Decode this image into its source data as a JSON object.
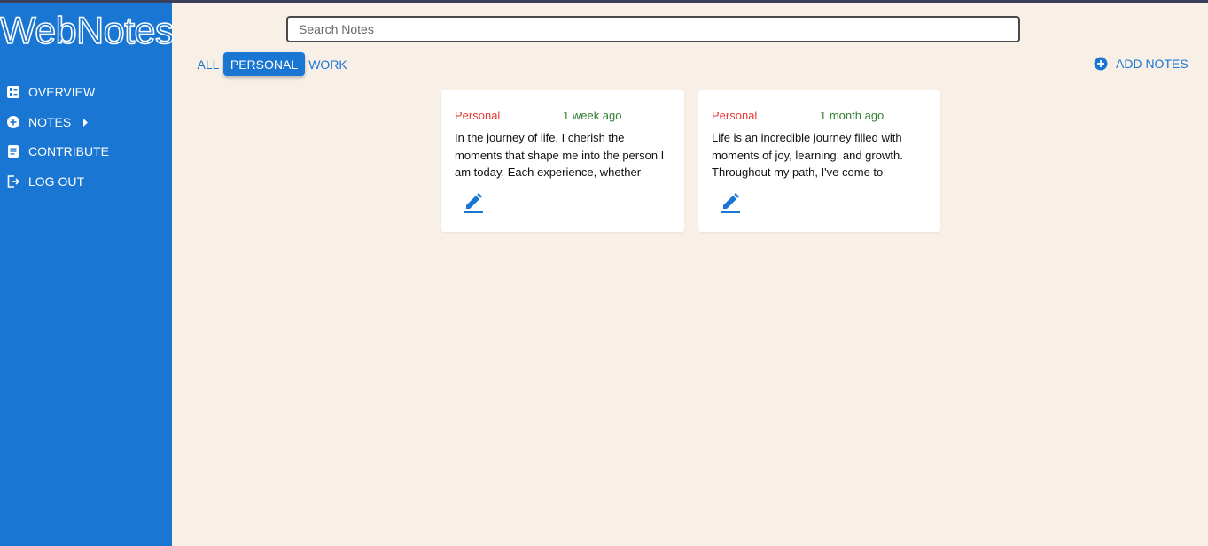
{
  "app": {
    "title": "WebNotes"
  },
  "sidebar": {
    "items": [
      {
        "label": "OVERVIEW",
        "icon": "dashboard-icon"
      },
      {
        "label": "NOTES",
        "icon": "add-circle-icon"
      },
      {
        "label": "CONTRIBUTE",
        "icon": "article-icon"
      },
      {
        "label": "LOG OUT",
        "icon": "logout-icon"
      }
    ]
  },
  "search": {
    "placeholder": "Search Notes",
    "value": ""
  },
  "tabs": [
    {
      "label": "ALL",
      "active": false
    },
    {
      "label": "PERSONAL",
      "active": true
    },
    {
      "label": "WORK",
      "active": false
    }
  ],
  "add_notes": {
    "label": "ADD NOTES",
    "icon": "add-circle-icon"
  },
  "notes": [
    {
      "category": "Personal",
      "time": "1 week ago",
      "text": "In the journey of life, I cherish the moments that shape me into the person I am today. Each experience, whether"
    },
    {
      "category": "Personal",
      "time": "1 month ago",
      "text": "Life is an incredible journey filled with moments of joy, learning, and growth. Throughout my path, I've come to"
    }
  ],
  "colors": {
    "primary": "#1976d2",
    "background": "#f8f0e6",
    "category": "#e53935",
    "time": "#2e7d32"
  }
}
